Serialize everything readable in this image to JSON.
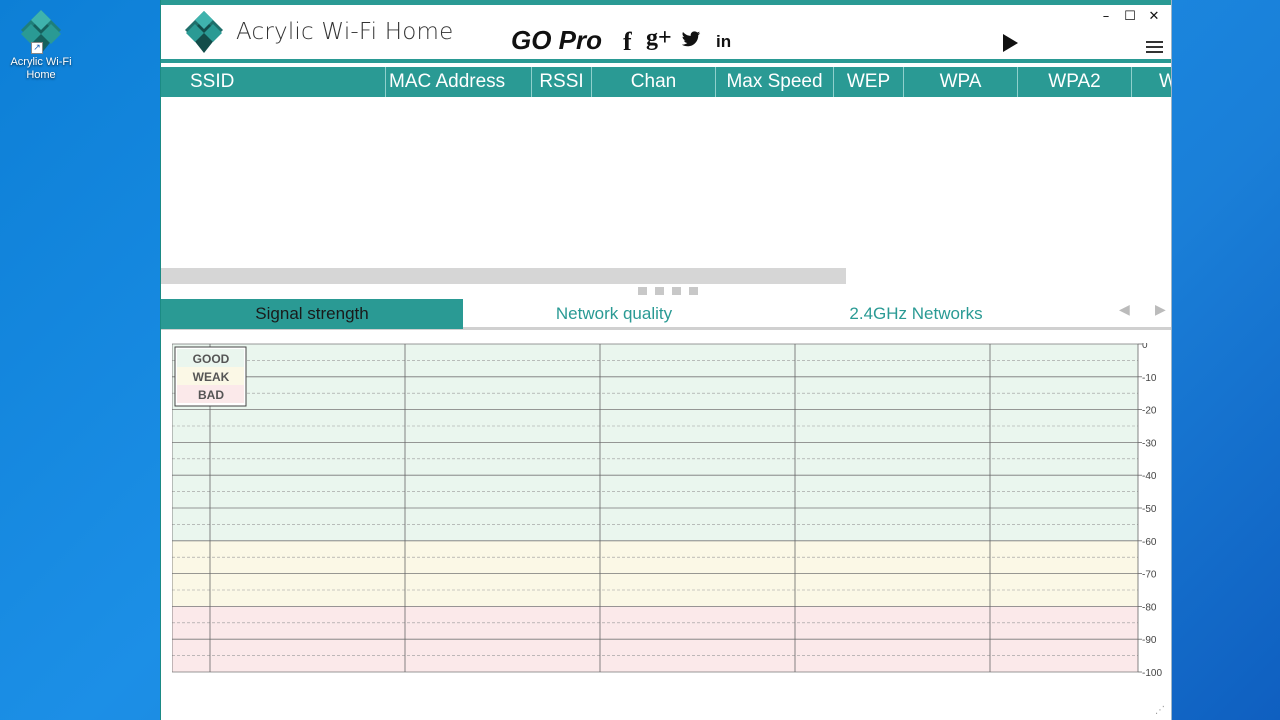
{
  "desktop": {
    "icon_label": "Acrylic Wi-Fi Home"
  },
  "window": {
    "title": "Acrylic Wi-Fi Home",
    "go_pro": "GO Pro",
    "social": {
      "facebook": "f",
      "googleplus": "g+",
      "linkedin": "in"
    },
    "controls": {
      "minimize": "–",
      "maximize": "☐",
      "close": "✕"
    },
    "accent_color": "#2a9a94"
  },
  "columns": [
    {
      "label": "SSID"
    },
    {
      "label": "MAC Address"
    },
    {
      "label": "RSSI"
    },
    {
      "label": "Chan"
    },
    {
      "label": "Max Speed"
    },
    {
      "label": "WEP"
    },
    {
      "label": "WPA"
    },
    {
      "label": "WPA2"
    },
    {
      "label": "W"
    }
  ],
  "tabs": [
    {
      "label": "Signal strength",
      "active": true
    },
    {
      "label": "Network quality",
      "active": false
    },
    {
      "label": "2.4GHz Networks",
      "active": false
    }
  ],
  "legend": {
    "good": "GOOD",
    "weak": "WEAK",
    "bad": "BAD"
  },
  "chart_data": {
    "type": "line",
    "y_ticks": [
      "0",
      "-10",
      "-20",
      "-30",
      "-40",
      "-50",
      "-60",
      "-70",
      "-80",
      "-90",
      "-100"
    ],
    "ylim": [
      -100,
      0
    ],
    "zones": [
      {
        "name": "GOOD",
        "from": 0,
        "to": -60,
        "color": "#eaf6ee"
      },
      {
        "name": "WEAK",
        "from": -60,
        "to": -80,
        "color": "#fbf8e6"
      },
      {
        "name": "BAD",
        "from": -80,
        "to": -100,
        "color": "#fbe9ea"
      }
    ],
    "series": []
  }
}
